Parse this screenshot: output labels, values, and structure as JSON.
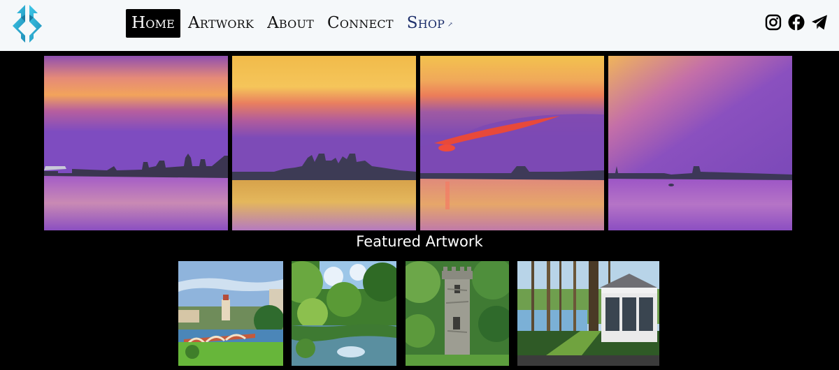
{
  "nav": {
    "items": [
      {
        "label": "Home",
        "active": true
      },
      {
        "label": "Artwork",
        "active": false
      },
      {
        "label": "About",
        "active": false
      },
      {
        "label": "Connect",
        "active": false
      },
      {
        "label": "Shop",
        "active": false,
        "external": true
      }
    ]
  },
  "socials": [
    "instagram-icon",
    "facebook-icon",
    "telegram-icon"
  ],
  "featured": {
    "title": "Featured Artwork"
  },
  "colors": {
    "header_bg": "#f5f8fa",
    "logo_blue": "#2fb3d6",
    "shop_link": "#1d2f6b",
    "page_bg": "#000000"
  }
}
